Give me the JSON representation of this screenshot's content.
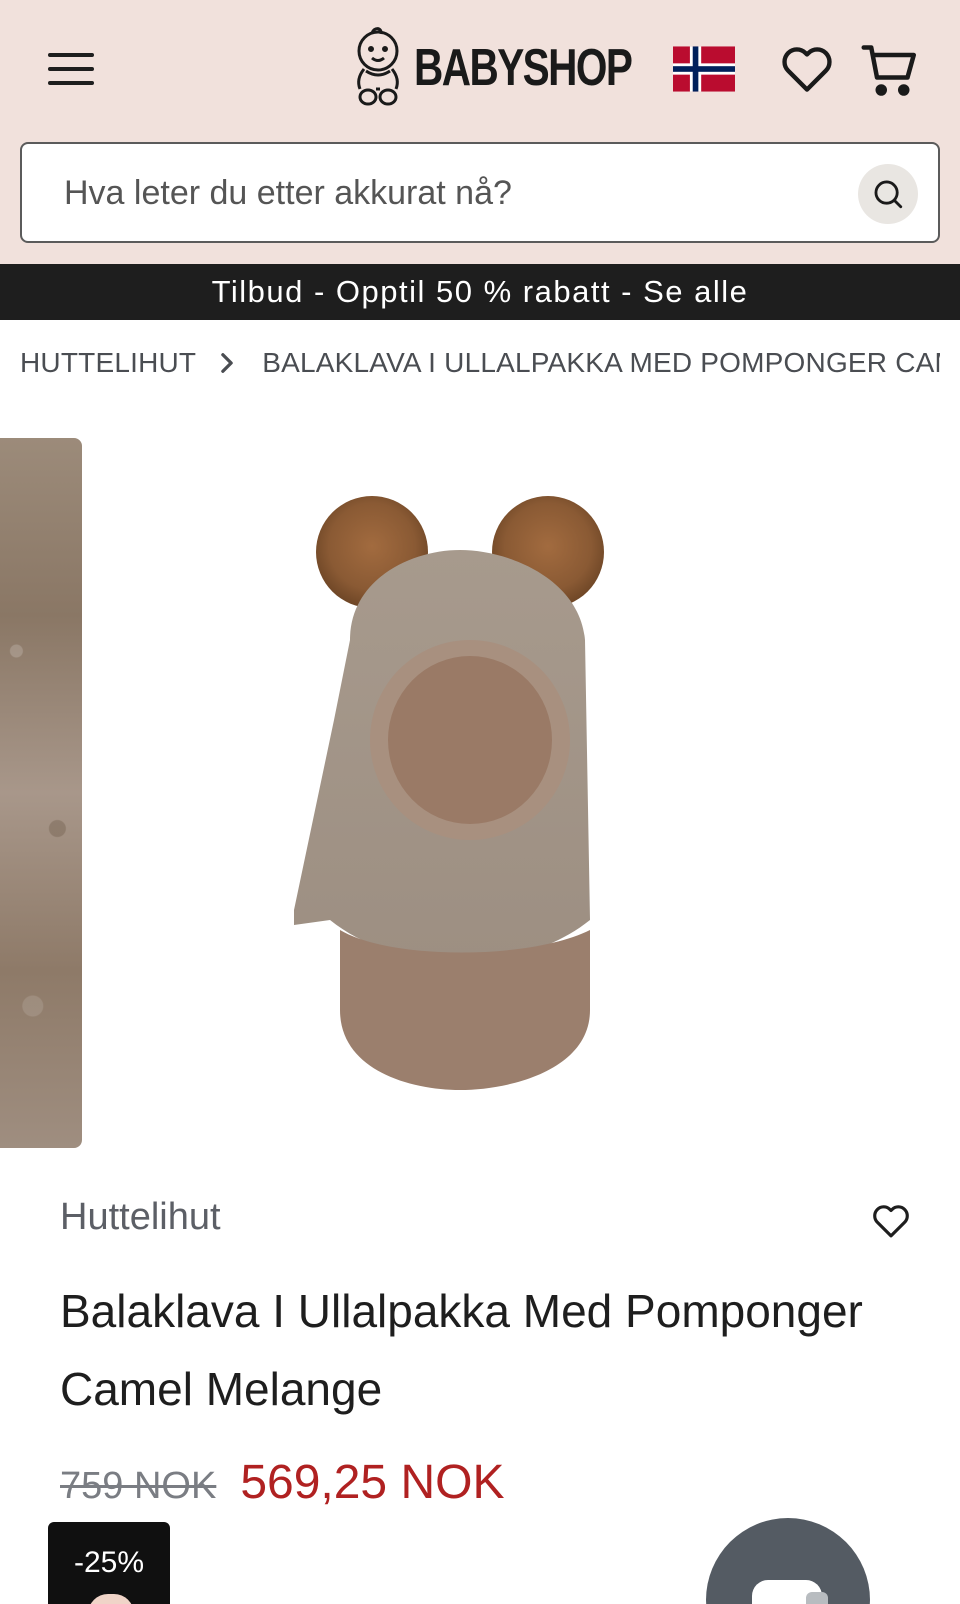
{
  "header": {
    "menu_icon": "hamburger-menu-icon",
    "logo_text": "BABYSHOP",
    "flag": "norway-flag-icon",
    "wishlist_icon": "heart-outline-icon",
    "cart_icon": "shopping-cart-icon",
    "background": "#f1e1dc"
  },
  "search": {
    "placeholder": "Hva leter du etter akkurat nå?",
    "icon": "search-icon"
  },
  "promo_banner": {
    "text": "Tilbud - Opptil 50 % rabatt - Se alle",
    "background": "#1e1e1e"
  },
  "breadcrumb": {
    "items": [
      "HUTTELIHUT",
      "BALAKLAVA I ULLALPAKKA MED POMPONGER CAMEL MELANGE"
    ],
    "separator_icon": "chevron-right-icon"
  },
  "product": {
    "brand": "Huttelihut",
    "title": "Balaklava I Ullalpakka Med Pomponger Camel Melange",
    "old_price": "759 NOK",
    "new_price": "569,25 NOK",
    "discount_badge": "-25%",
    "sale_price_color": "#b02121"
  },
  "chat": {
    "icon": "chat-bubble-icon"
  }
}
